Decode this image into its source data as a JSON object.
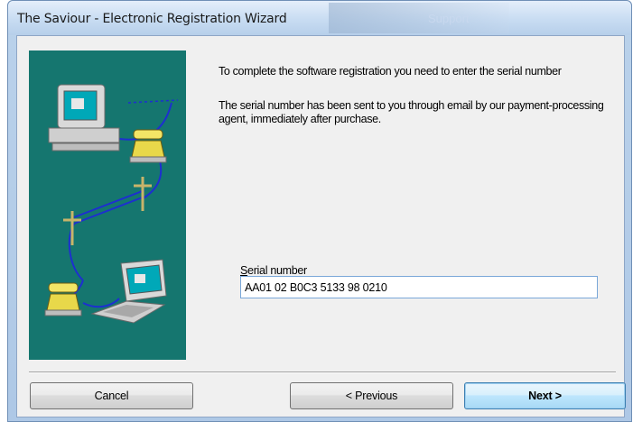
{
  "window": {
    "title": "The Saviour - Electronic Registration Wizard",
    "background_tab_label": "Support"
  },
  "content": {
    "intro": "To complete the software registration you need to enter the serial number",
    "detail": "The serial number has been sent to you through email by our payment-processing agent, immediately after purchase."
  },
  "serial": {
    "label_mnemonic": "S",
    "label_rest": "erial number",
    "value": "AA01 02 B0C3 5133 98 0210"
  },
  "buttons": {
    "cancel": "Cancel",
    "previous": "< Previous",
    "next": "Next >"
  },
  "illustration": {
    "icons": [
      "desktop-computer-icon",
      "telephone-icon",
      "utility-pole-icon",
      "laptop-icon"
    ],
    "background_color": "#15766f"
  },
  "colors": {
    "accent": "#3c7fb1",
    "illustration_bg": "#15766f"
  }
}
